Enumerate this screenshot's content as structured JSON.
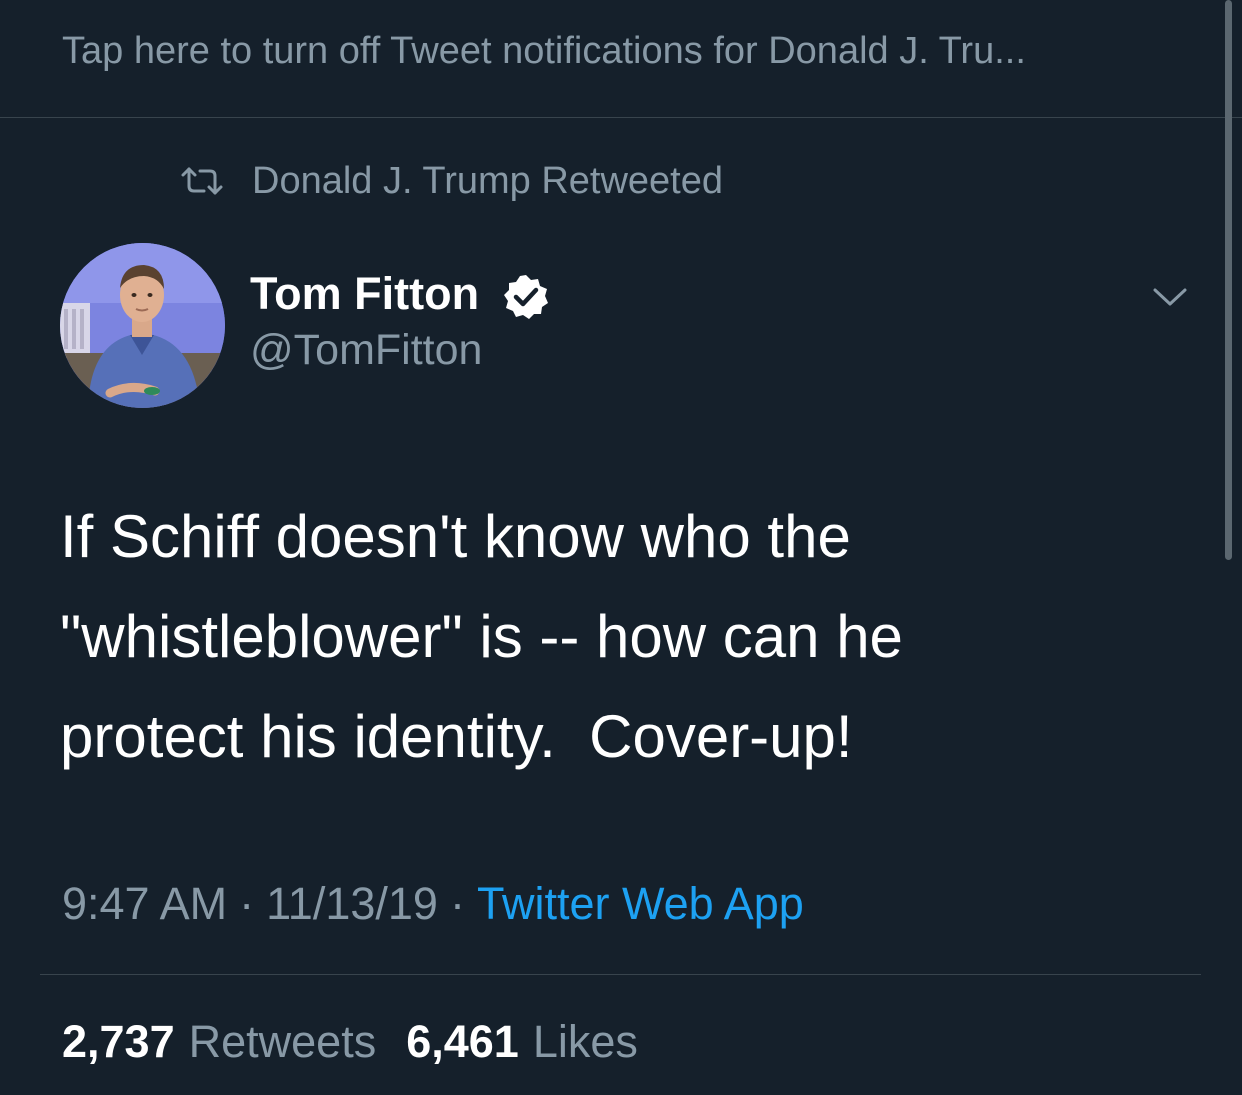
{
  "notification_bar": {
    "text": "Tap here to turn off Tweet notifications for Donald J. Tru..."
  },
  "retweet_context": {
    "icon": "retweet-icon",
    "text": "Donald J. Trump Retweeted"
  },
  "author": {
    "display_name": "Tom Fitton",
    "handle": "@TomFitton",
    "verified_icon": "verified-badge-icon",
    "menu_icon": "chevron-down-icon"
  },
  "tweet": {
    "lines": [
      "If Schiff doesn't know who the",
      "\"whistleblower\" is -- how can he",
      "protect his identity.  Cover-up!"
    ]
  },
  "meta": {
    "time": "9:47 AM",
    "separator": "·",
    "date": "11/13/19",
    "source": "Twitter Web App"
  },
  "stats": {
    "retweets_count": "2,737",
    "retweets_label": "Retweets",
    "likes_count": "6,461",
    "likes_label": "Likes"
  },
  "colors": {
    "background": "#15202b",
    "secondary_text": "#8899a6",
    "link": "#1da1f2",
    "divider": "#38444d"
  }
}
